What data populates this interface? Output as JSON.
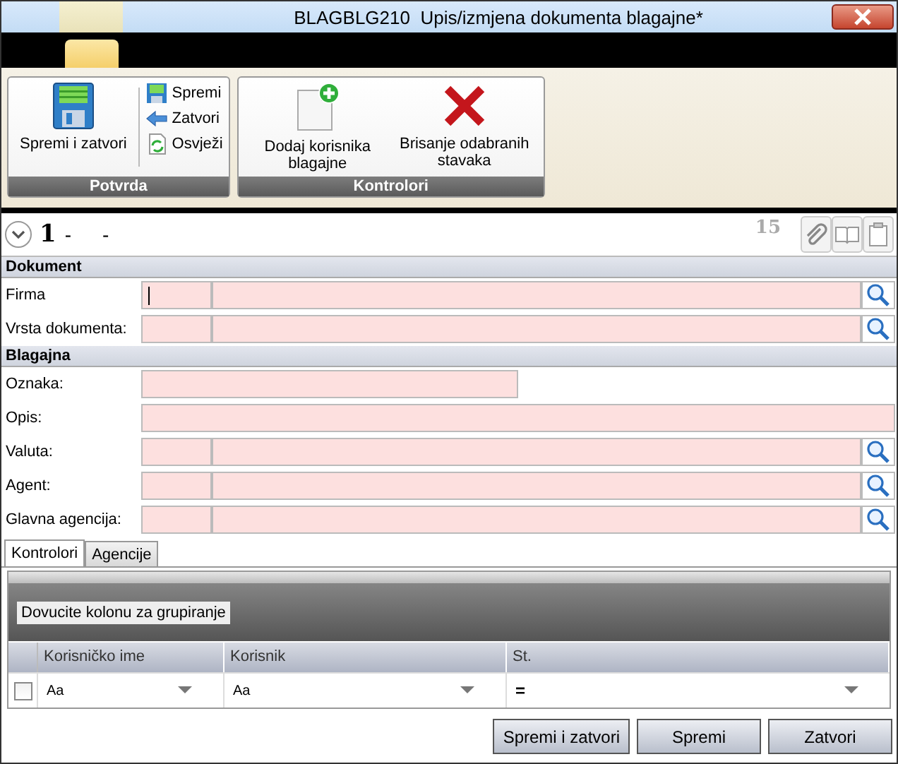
{
  "window": {
    "title": "BLAGBLG210  Upis/izmjena dokumenta blagajne*"
  },
  "ribbon": {
    "groups": [
      {
        "label": "Potvrda",
        "large": [
          {
            "label": "Spremi i zatvori",
            "kind": "save"
          }
        ],
        "small": [
          {
            "label": "Spremi",
            "kind": "save"
          },
          {
            "label": "Zatvori",
            "kind": "close"
          },
          {
            "label": "Osvježi",
            "kind": "refresh"
          }
        ]
      },
      {
        "label": "Kontrolori",
        "large": [
          {
            "label": "Dodaj korisnika blagajne",
            "kind": "add"
          },
          {
            "label": "Brisanje odabranih stavaka",
            "kind": "delete"
          }
        ]
      }
    ]
  },
  "record": {
    "number": "1",
    "dash_1": "-",
    "dash_2": "-",
    "count": "15",
    "tools": [
      {
        "kind": "attach",
        "disabled": true
      },
      {
        "kind": "view",
        "disabled": true
      },
      {
        "kind": "paste",
        "disabled": true
      }
    ]
  },
  "sections": [
    {
      "title": "Dokument",
      "fields": [
        {
          "label": "Firma",
          "kind": "lookup",
          "focused": true
        },
        {
          "label": "Vrsta dokumenta:",
          "kind": "lookup",
          "focused": false
        }
      ]
    },
    {
      "title": "Blagajna",
      "fields": [
        {
          "label": "Oznaka:",
          "kind": "short",
          "focused": false
        },
        {
          "label": "Opis:",
          "kind": "text",
          "focused": false
        },
        {
          "label": "Valuta:",
          "kind": "lookup",
          "focused": false
        },
        {
          "label": "Agent:",
          "kind": "lookup",
          "focused": false
        },
        {
          "label": "Glavna agencija:",
          "kind": "lookup",
          "focused": false
        }
      ]
    }
  ],
  "tabs": [
    {
      "label": "Kontrolori",
      "selected": true
    },
    {
      "label": "Agencije",
      "selected": false
    }
  ],
  "grid": {
    "group_hint": "Dovucite kolonu za grupiranje",
    "columns": [
      "Korisničko ime",
      "Korisnik",
      "St."
    ],
    "filter": {
      "checked": false,
      "cells": [
        "Aa",
        "Aa",
        "="
      ]
    }
  },
  "buttons": [
    "Spremi i zatvori",
    "Spremi",
    "Zatvori"
  ]
}
